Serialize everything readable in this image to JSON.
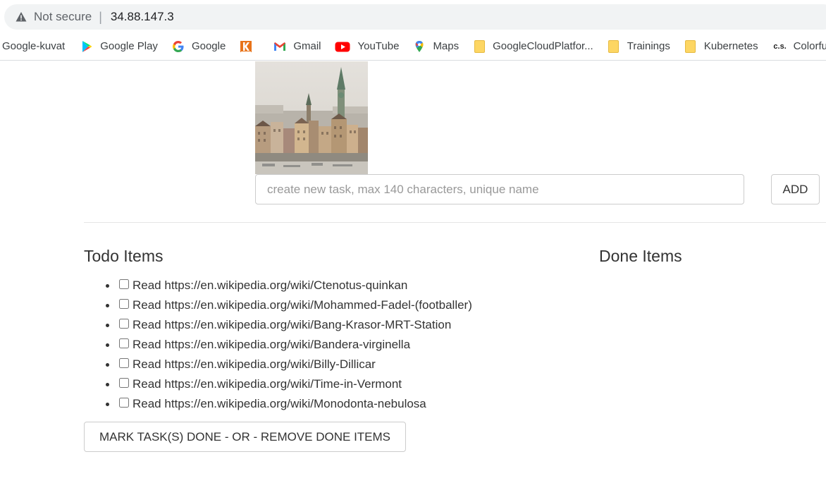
{
  "browser": {
    "security_label": "Not secure",
    "url": "34.88.147.3"
  },
  "bookmarks": [
    {
      "label": "Google-kuvat",
      "icon": "none"
    },
    {
      "label": "Google Play",
      "icon": "google-play-icon"
    },
    {
      "label": "Google",
      "icon": "google-g-icon"
    },
    {
      "label": "",
      "icon": "k-icon"
    },
    {
      "label": "Gmail",
      "icon": "gmail-icon"
    },
    {
      "label": "YouTube",
      "icon": "youtube-icon"
    },
    {
      "label": "Maps",
      "icon": "maps-pin-icon"
    },
    {
      "label": "GoogleCloudPlatfor...",
      "icon": "folder-icon"
    },
    {
      "label": "Trainings",
      "icon": "folder-icon"
    },
    {
      "label": "Kubernetes",
      "icon": "folder-icon"
    },
    {
      "label": "Colorfu",
      "icon": "cs-icon"
    }
  ],
  "form": {
    "input_placeholder": "create new task, max 140 characters, unique name",
    "input_value": "",
    "add_label": "ADD"
  },
  "todo": {
    "title": "Todo Items",
    "items": [
      "Read https://en.wikipedia.org/wiki/Ctenotus-quinkan",
      "Read https://en.wikipedia.org/wiki/Mohammed-Fadel-(footballer)",
      "Read https://en.wikipedia.org/wiki/Bang-Krasor-MRT-Station",
      "Read https://en.wikipedia.org/wiki/Bandera-virginella",
      "Read https://en.wikipedia.org/wiki/Billy-Dillicar",
      "Read https://en.wikipedia.org/wiki/Time-in-Vermont",
      "Read https://en.wikipedia.org/wiki/Monodonta-nebulosa"
    ]
  },
  "done": {
    "title": "Done Items",
    "items": []
  },
  "actions": {
    "mark_done_label": "MARK TASK(S) DONE - OR - REMOVE DONE ITEMS"
  },
  "colors": {
    "omnibox_bg": "#f1f3f4",
    "youtube_red": "#ff0000",
    "gmail_red": "#ea4335",
    "k_orange": "#e8731a"
  }
}
